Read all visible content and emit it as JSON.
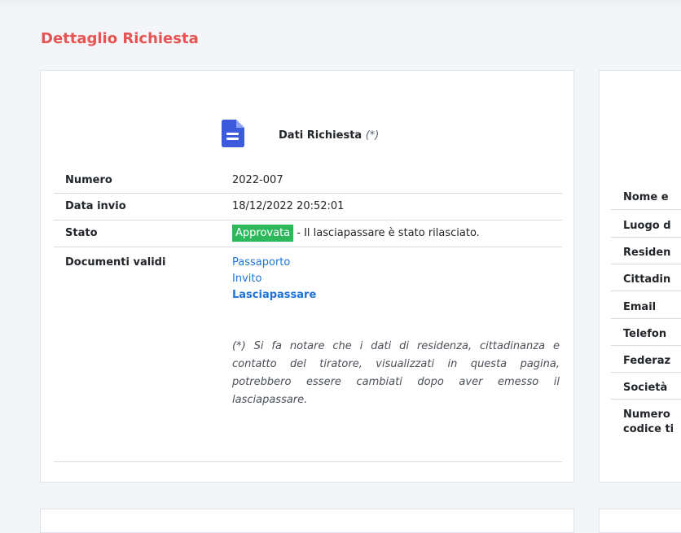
{
  "page": {
    "title": "Dettaglio Richiesta"
  },
  "request": {
    "header_title": "Dati Richiesta",
    "header_note": "(*)",
    "icon": "file-document-icon",
    "rows": {
      "numero": {
        "label": "Numero",
        "value": "2022-007"
      },
      "data_invio": {
        "label": "Data invio",
        "value": "18/12/2022 20:52:01"
      },
      "stato": {
        "label": "Stato",
        "badge": "Approvata",
        "text": " - Il lasciapassare è stato rilasciato.",
        "badge_color": "#2eb85c"
      },
      "documenti": {
        "label": "Documenti validi",
        "links": [
          "Passaporto",
          "Invito",
          "Lasciapassare"
        ]
      }
    },
    "note": "(*) Si fa notare che i dati di residenza, cittadinanza e contatto del tiratore, visualizzati in questa pagina, potrebbero essere cambiati dopo aver emesso il lasciapassare."
  },
  "person": {
    "labels": [
      "Nome e",
      "Luogo d",
      "Residen",
      "Cittadin",
      "Email",
      "Telefon",
      "Federaz",
      "Società",
      "Numero",
      "codice ti"
    ]
  },
  "colors": {
    "title": "#e55353",
    "link": "#1f73d8",
    "icon": "#3b5bdb",
    "badge": "#2eb85c"
  }
}
